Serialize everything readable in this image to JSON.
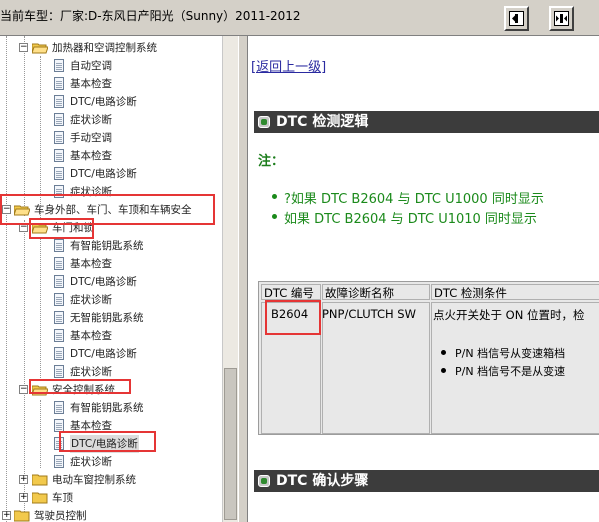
{
  "window": {
    "title": "当前车型：厂家:D-东风日产阳光（Sunny）2011-2012"
  },
  "toolbar": {
    "buttons": [
      "expand-button",
      "collapse-button"
    ]
  },
  "tree": {
    "items": [
      {
        "label": "加热器和空调控制系统",
        "type": "folder"
      },
      {
        "label": "自动空调",
        "type": "doc"
      },
      {
        "label": "基本检查",
        "type": "doc"
      },
      {
        "label": "DTC/电路诊断",
        "type": "doc"
      },
      {
        "label": "症状诊断",
        "type": "doc"
      },
      {
        "label": "手动空调",
        "type": "doc"
      },
      {
        "label": "基本检查",
        "type": "doc"
      },
      {
        "label": "DTC/电路诊断",
        "type": "doc"
      },
      {
        "label": "症状诊断",
        "type": "doc"
      },
      {
        "label": "车身外部、车门、车顶和车辆安全",
        "type": "folder"
      },
      {
        "label": "车门和锁",
        "type": "folder"
      },
      {
        "label": "有智能钥匙系统",
        "type": "doc"
      },
      {
        "label": "基本检查",
        "type": "doc"
      },
      {
        "label": "DTC/电路诊断",
        "type": "doc"
      },
      {
        "label": "症状诊断",
        "type": "doc"
      },
      {
        "label": "无智能钥匙系统",
        "type": "doc"
      },
      {
        "label": "基本检查",
        "type": "doc"
      },
      {
        "label": "DTC/电路诊断",
        "type": "doc"
      },
      {
        "label": "症状诊断",
        "type": "doc"
      },
      {
        "label": "安全控制系统",
        "type": "folder"
      },
      {
        "label": "有智能钥匙系统",
        "type": "doc"
      },
      {
        "label": "基本检查",
        "type": "doc"
      },
      {
        "label": "DTC/电路诊断",
        "type": "doc",
        "selected": true
      },
      {
        "label": "症状诊断",
        "type": "doc"
      },
      {
        "label": "电动车窗控制系统",
        "type": "folder"
      },
      {
        "label": "车顶",
        "type": "folder"
      },
      {
        "label": "驾驶员控制",
        "type": "folder"
      }
    ]
  },
  "content": {
    "back_link": "[返回上一级]",
    "section1": "DTC 检测逻辑",
    "note_label": "注：",
    "note_items": [
      "?如果  DTC B2604 与  DTC U1000 同时显示",
      "如果  DTC B2604 与  DTC U1010 同时显示"
    ],
    "table": {
      "headers": [
        "DTC 编号",
        "故障诊断名称",
        "DTC 检测条件"
      ],
      "row": {
        "code": "B2604",
        "name": "PNP/CLUTCH SW",
        "condition": "点火开关处于  ON 位置时，检",
        "bullets": [
          "P/N 档信号从变速箱档",
          "P/N 档信号不是从变速"
        ]
      }
    },
    "section2": "DTC 确认步骤"
  },
  "colors": {
    "annotation": "#e53535",
    "note_green": "#1b8a1b",
    "section_bg": "#3c3c3c",
    "link": "#2a2aa0"
  }
}
